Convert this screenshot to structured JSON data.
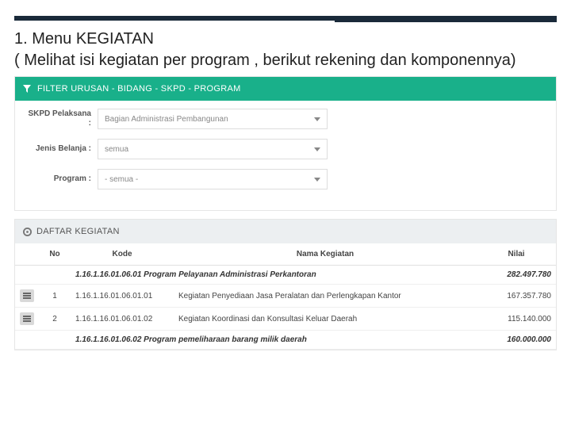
{
  "heading_line1": "1. Menu KEGIATAN",
  "heading_line2": "( Melihat isi kegiatan per program , berikut rekening dan komponennya)",
  "filter_bar": {
    "title": "FILTER URUSAN - BIDANG - SKPD - PROGRAM"
  },
  "form": {
    "skpd_label": "SKPD Pelaksana :",
    "skpd_value": "Bagian Administrasi Pembangunan",
    "jenis_label": "Jenis Belanja :",
    "jenis_value": "semua",
    "program_label": "Program :",
    "program_value": "- semua -"
  },
  "list_bar": {
    "title": "DAFTAR KEGIATAN"
  },
  "columns": {
    "no": "No",
    "kode": "Kode",
    "nama": "Nama Kegiatan",
    "nilai": "Nilai"
  },
  "groups": [
    {
      "kode": "1.16.1.16.01.06.01",
      "nama": "Program Pelayanan Administrasi Perkantoran",
      "nilai": "282.497.780",
      "rows": [
        {
          "no": "1",
          "kode": "1.16.1.16.01.06.01.01",
          "nama": "Kegiatan Penyediaan Jasa Peralatan dan Perlengkapan Kantor",
          "nilai": "167.357.780"
        },
        {
          "no": "2",
          "kode": "1.16.1.16.01.06.01.02",
          "nama": "Kegiatan Koordinasi dan Konsultasi Keluar Daerah",
          "nilai": "115.140.000"
        }
      ]
    },
    {
      "kode": "1.16.1.16.01.06.02",
      "nama": "Program pemeliharaan barang milik daerah",
      "nilai": "160.000.000",
      "rows": []
    }
  ]
}
